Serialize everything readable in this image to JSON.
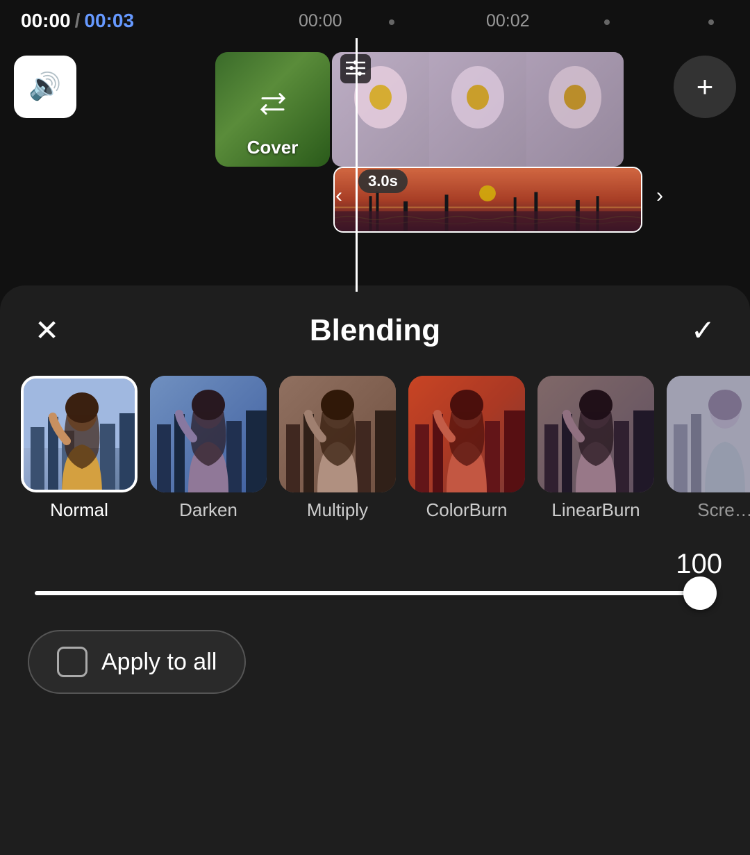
{
  "timeline": {
    "current_time": "00:00",
    "separator": "/",
    "total_time": "00:03",
    "marker_00": "00:00",
    "marker_02": "00:02",
    "duration_badge": "3.0s"
  },
  "cover": {
    "label": "Cover"
  },
  "controls": {
    "volume_icon": "🔊",
    "plus_icon": "+",
    "arrow_left": "‹",
    "arrow_right": "›"
  },
  "panel": {
    "title": "Blending",
    "close_label": "✕",
    "confirm_label": "✓"
  },
  "blend_modes": [
    {
      "id": "normal",
      "label": "Normal",
      "selected": true
    },
    {
      "id": "darken",
      "label": "Darken",
      "selected": false
    },
    {
      "id": "multiply",
      "label": "Multiply",
      "selected": false
    },
    {
      "id": "colorburn",
      "label": "ColorBurn",
      "selected": false
    },
    {
      "id": "linearburn",
      "label": "LinearBurn",
      "selected": false
    },
    {
      "id": "screen",
      "label": "Scre…",
      "selected": false
    }
  ],
  "opacity": {
    "value": "100",
    "slider_percent": 96
  },
  "apply_all": {
    "label": "Apply to all",
    "checked": false
  }
}
